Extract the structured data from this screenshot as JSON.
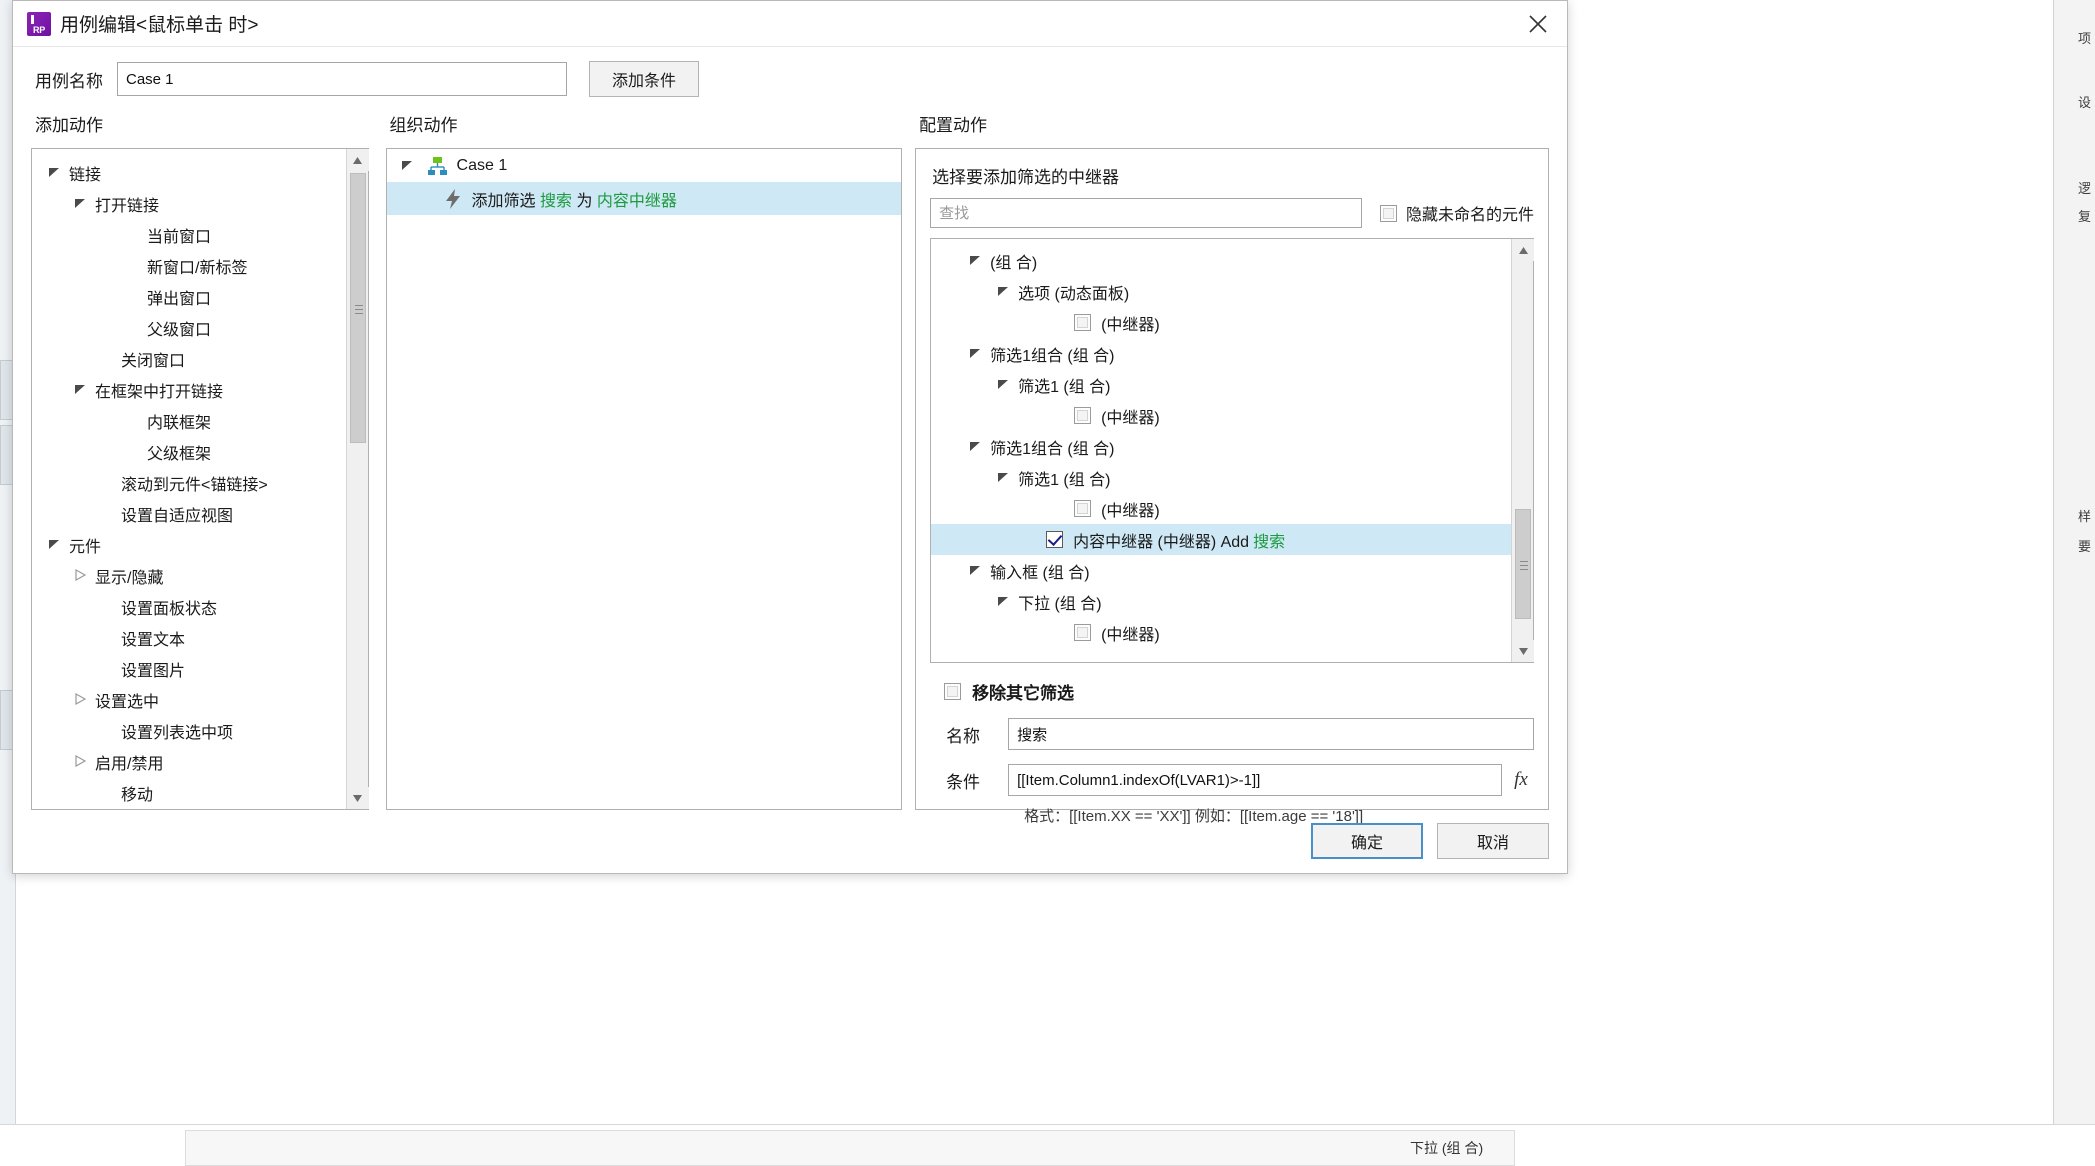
{
  "window": {
    "title": "用例编辑<鼠标单击 时>",
    "logo_text": "RP",
    "close_icon": "close-icon"
  },
  "name_row": {
    "label": "用例名称",
    "value": "Case 1",
    "add_condition_label": "添加条件"
  },
  "columns": {
    "add_action_title": "添加动作",
    "organize_action_title": "组织动作",
    "configure_action_title": "配置动作"
  },
  "add_action_tree": [
    {
      "label": "链接",
      "indent": 0,
      "caret": "down"
    },
    {
      "label": "打开链接",
      "indent": 1,
      "caret": "down"
    },
    {
      "label": "当前窗口",
      "indent": 3,
      "caret": "none"
    },
    {
      "label": "新窗口/新标签",
      "indent": 3,
      "caret": "none"
    },
    {
      "label": "弹出窗口",
      "indent": 3,
      "caret": "none"
    },
    {
      "label": "父级窗口",
      "indent": 3,
      "caret": "none"
    },
    {
      "label": "关闭窗口",
      "indent": 2,
      "caret": "none"
    },
    {
      "label": "在框架中打开链接",
      "indent": 1,
      "caret": "down"
    },
    {
      "label": "内联框架",
      "indent": 3,
      "caret": "none"
    },
    {
      "label": "父级框架",
      "indent": 3,
      "caret": "none"
    },
    {
      "label": "滚动到元件<锚链接>",
      "indent": 2,
      "caret": "none"
    },
    {
      "label": "设置自适应视图",
      "indent": 2,
      "caret": "none"
    },
    {
      "label": "元件",
      "indent": 0,
      "caret": "down"
    },
    {
      "label": "显示/隐藏",
      "indent": 1,
      "caret": "right"
    },
    {
      "label": "设置面板状态",
      "indent": 2,
      "caret": "none"
    },
    {
      "label": "设置文本",
      "indent": 2,
      "caret": "none"
    },
    {
      "label": "设置图片",
      "indent": 2,
      "caret": "none"
    },
    {
      "label": "设置选中",
      "indent": 1,
      "caret": "right"
    },
    {
      "label": "设置列表选中项",
      "indent": 2,
      "caret": "none"
    },
    {
      "label": "启用/禁用",
      "indent": 1,
      "caret": "right"
    },
    {
      "label": "移动",
      "indent": 2,
      "caret": "none"
    }
  ],
  "organize_action": {
    "case_label": "Case 1",
    "case_icon": "sitemap-icon",
    "action_icon": "lightning-bolt-icon",
    "action_parts": [
      {
        "text": "添加筛选",
        "accent": false
      },
      {
        "text": "搜索",
        "accent": true
      },
      {
        "text": "为",
        "accent": false
      },
      {
        "text": "内容中继器",
        "accent": true
      }
    ]
  },
  "configure_action": {
    "section_title": "选择要添加筛选的中继器",
    "search_placeholder": "查找",
    "search_value": "",
    "hide_unnamed_label": "隐藏未命名的元件",
    "hide_unnamed_checked": false,
    "repeater_tree": [
      {
        "label": "(组 合)",
        "indent": 1,
        "caret": "down",
        "checkbox": false,
        "selected": false
      },
      {
        "label": "选项 (动态面板)",
        "indent": 2,
        "caret": "down",
        "checkbox": false,
        "selected": false
      },
      {
        "label": "(中继器)",
        "indent": 4,
        "caret": "none",
        "checkbox": true,
        "checked": false,
        "selected": false
      },
      {
        "label": "筛选1组合 (组 合)",
        "indent": 1,
        "caret": "down",
        "checkbox": false,
        "selected": false
      },
      {
        "label": "筛选1 (组 合)",
        "indent": 2,
        "caret": "down",
        "checkbox": false,
        "selected": false
      },
      {
        "label": "(中继器)",
        "indent": 4,
        "caret": "none",
        "checkbox": true,
        "checked": false,
        "selected": false
      },
      {
        "label": "筛选1组合 (组 合)",
        "indent": 1,
        "caret": "down",
        "checkbox": false,
        "selected": false
      },
      {
        "label": "筛选1 (组 合)",
        "indent": 2,
        "caret": "down",
        "checkbox": false,
        "selected": false
      },
      {
        "label": "(中继器)",
        "indent": 4,
        "caret": "none",
        "checkbox": true,
        "checked": false,
        "selected": false
      },
      {
        "label": "内容中继器 (中继器) Add ",
        "accent": "搜索",
        "indent": 3,
        "caret": "none",
        "checkbox": true,
        "checked": true,
        "selected": true
      },
      {
        "label": "输入框 (组 合)",
        "indent": 1,
        "caret": "down",
        "checkbox": false,
        "selected": false
      },
      {
        "label": "下拉 (组 合)",
        "indent": 2,
        "caret": "down",
        "checkbox": false,
        "selected": false
      },
      {
        "label": "(中继器)",
        "indent": 4,
        "caret": "none",
        "checkbox": true,
        "checked": false,
        "selected": false
      }
    ],
    "remove_other_filters_label": "移除其它筛选",
    "remove_other_filters_checked": false,
    "name_label": "名称",
    "name_value": "搜索",
    "condition_label": "条件",
    "condition_value": "[[Item.Column1.indexOf(LVAR1)>-1]]",
    "fx_label": "fx",
    "format_hint": "格式：[[Item.XX == 'XX']] 例如：[[Item.age == '18']]"
  },
  "footer": {
    "ok_label": "确定",
    "cancel_label": "取消"
  },
  "background": {
    "right_labels": [
      "项",
      "设",
      "逻",
      "复",
      "样",
      "要"
    ],
    "bottom_label": "下拉 (组 合)"
  },
  "colors": {
    "accent_green": "#1c9b3e",
    "selection_blue": "#cfe8f5",
    "brand_purple": "#8e22b8",
    "primary_border": "#4a90c8"
  }
}
